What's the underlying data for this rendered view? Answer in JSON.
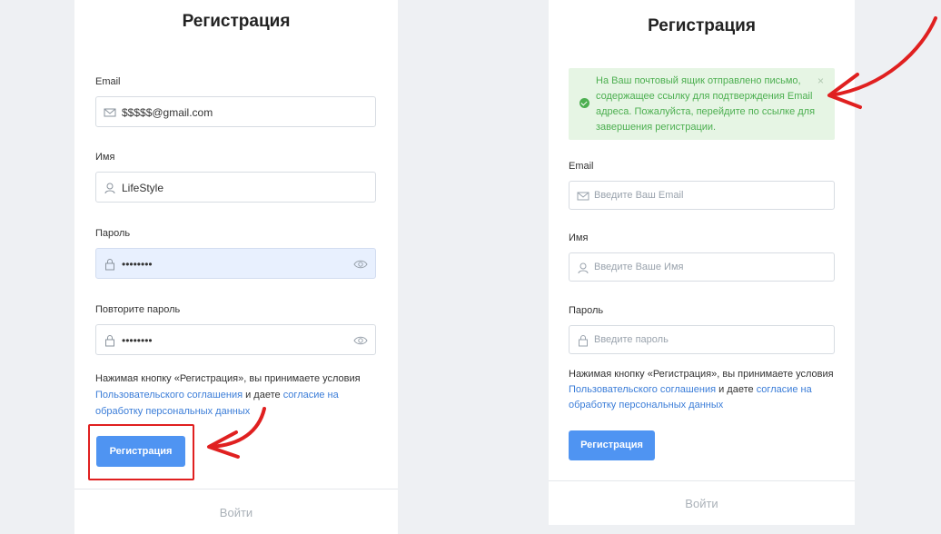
{
  "left_form": {
    "title": "Регистрация",
    "email_label": "Email",
    "email_value": "$$$$$@gmail.com",
    "name_label": "Имя",
    "name_value": "LifeStyle",
    "password_label": "Пароль",
    "password_value": "••••••••",
    "repeat_password_label": "Повторите пароль",
    "repeat_password_value": "••••••••",
    "terms_prefix": "Нажимая кнопку «Регистрация», вы принимаете условия",
    "terms_link1": "Пользовательского соглашения",
    "terms_middle": " и даете ",
    "terms_link2a": "согласие на",
    "terms_link2b": "обработку персональных данных",
    "submit_label": "Регистрация",
    "login_link": "Войти"
  },
  "right_form": {
    "title": "Регистрация",
    "alert_text": "На Ваш почтовый ящик отправлено письмо, содержащее ссылку для подтверждения Email адреса. Пожалуйста, перейдите по ссылке для завершения регистрации.",
    "alert_close": "×",
    "email_label": "Email",
    "email_placeholder": "Введите Ваш Email",
    "name_label": "Имя",
    "name_placeholder": "Введите Ваше Имя",
    "password_label": "Пароль",
    "password_placeholder": "Введите пароль",
    "terms_prefix": "Нажимая кнопку «Регистрация», вы принимаете условия",
    "terms_link1": "Пользовательского соглашения",
    "terms_middle": " и даете ",
    "terms_link2a": "согласие на",
    "terms_link2b": "обработку персональных данных",
    "submit_label": "Регистрация",
    "login_link": "Войти"
  },
  "colors": {
    "accent": "#4f94f2",
    "link": "#3b7dd8",
    "success": "#4caf50",
    "annotation": "#e02020"
  }
}
